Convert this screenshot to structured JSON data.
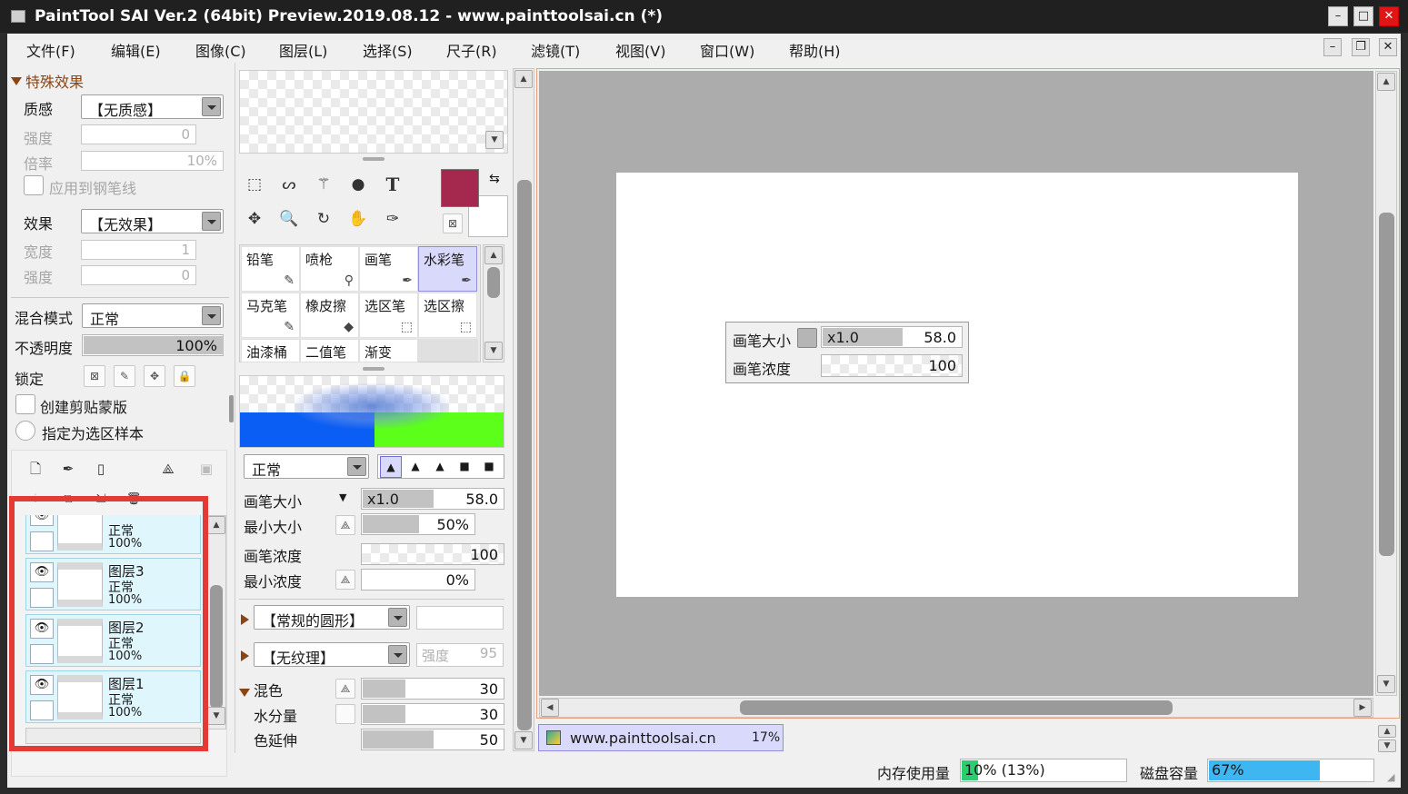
{
  "window": {
    "title": "PaintTool SAI Ver.2 (64bit) Preview.2019.08.12 - www.painttoolsai.cn (*)",
    "min": "–",
    "max": "□",
    "close": "✕"
  },
  "menu": [
    "文件(F)",
    "编辑(E)",
    "图像(C)",
    "图层(L)",
    "选择(S)",
    "尺子(R)",
    "滤镜(T)",
    "视图(V)",
    "窗口(W)",
    "帮助(H)"
  ],
  "effects": {
    "header": "特殊效果",
    "texture_label": "质感",
    "texture_value": "【无质感】",
    "strength_label": "强度",
    "strength_value": "0",
    "scale_label": "倍率",
    "scale_value": "10%",
    "apply_pen": "应用到钢笔线",
    "effect_label": "效果",
    "effect_value": "【无效果】",
    "width_label": "宽度",
    "width_value": "1",
    "strength2_label": "强度",
    "strength2_value": "0"
  },
  "layer_props": {
    "blend_label": "混合模式",
    "blend_value": "正常",
    "opacity_label": "不透明度",
    "opacity_value": "100%",
    "opacity_fraction": 1.0,
    "lock_label": "锁定",
    "clip": "创建剪贴蒙版",
    "sample": "指定为选区样本"
  },
  "layers": [
    {
      "name": "",
      "mode": "正常",
      "opacity": "100%"
    },
    {
      "name": "图层3",
      "mode": "正常",
      "opacity": "100%"
    },
    {
      "name": "图层2",
      "mode": "正常",
      "opacity": "100%"
    },
    {
      "name": "图层1",
      "mode": "正常",
      "opacity": "100%"
    }
  ],
  "tools": {
    "text_tool": "T",
    "primary_color": "#a5294f",
    "brushes": [
      {
        "name": "铅笔",
        "selected": false
      },
      {
        "name": "喷枪",
        "selected": false
      },
      {
        "name": "画笔",
        "selected": false
      },
      {
        "name": "水彩笔",
        "selected": true
      },
      {
        "name": "马克笔",
        "selected": false
      },
      {
        "name": "橡皮擦",
        "selected": false
      },
      {
        "name": "选区笔",
        "selected": false
      },
      {
        "name": "选区擦",
        "selected": false
      },
      {
        "name": "油漆桶",
        "selected": false
      },
      {
        "name": "二值笔",
        "selected": false
      },
      {
        "name": "渐变",
        "selected": false
      }
    ]
  },
  "brush_settings": {
    "mode": "正常",
    "size_label": "画笔大小",
    "size_mult": "x1.0",
    "size_value": "58.0",
    "min_size_label": "最小大小",
    "min_size_value": "50%",
    "density_label": "画笔浓度",
    "density_value": "100",
    "min_density_label": "最小浓度",
    "min_density_value": "0%",
    "shape": "【常规的圆形】",
    "texture": "【无纹理】",
    "texture_strength_label": "强度",
    "texture_strength_value": "95",
    "blend_label": "混色",
    "blend_value": "30",
    "water_label": "水分量",
    "water_value": "30",
    "extend_label": "色延伸",
    "extend_value": "50"
  },
  "canvas_popup": {
    "size_label": "画笔大小",
    "size_mult": "x1.0",
    "size_value": "58.0",
    "density_label": "画笔浓度",
    "density_value": "100"
  },
  "document_tab": {
    "name": "www.painttoolsai.cn",
    "zoom": "17%"
  },
  "status": {
    "memory_label": "内存使用量",
    "memory_value": "10% (13%)",
    "memory_fraction": 0.1,
    "disk_label": "磁盘容量",
    "disk_value": "67%",
    "disk_fraction": 0.67
  },
  "colors": {
    "highlight_box": "#e53935",
    "accent_blue": "#3db6f2",
    "selected_brush": "#d9d9fb"
  }
}
